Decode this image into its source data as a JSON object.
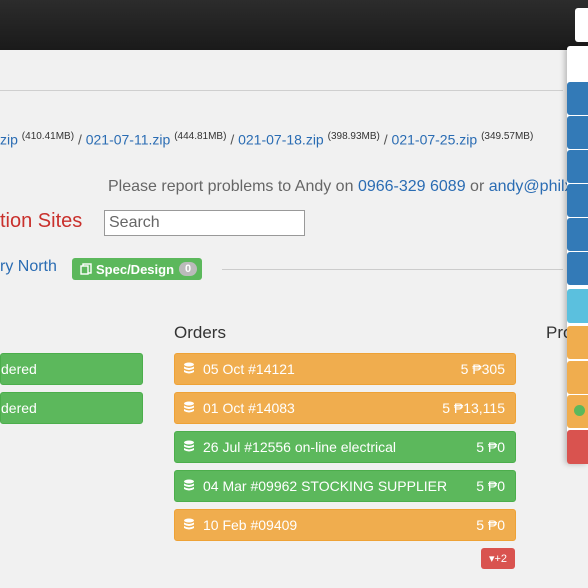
{
  "downloads": [
    {
      "name": "zip",
      "size": "(410.41MB)"
    },
    {
      "name": "021-07-11.zip",
      "size": "(444.81MB)"
    },
    {
      "name": "021-07-18.zip",
      "size": "(398.93MB)"
    },
    {
      "name": "021-07-25.zip",
      "size": "(349.57MB)"
    }
  ],
  "downloads_sep": "/",
  "report": {
    "prefix": "Please report problems to Andy on",
    "phone": "0966-329 6089",
    "or": "or",
    "email": "andy@philx.c"
  },
  "sites_title": "tion Sites",
  "search_placeholder": "Search",
  "site_link": "ry North",
  "spec": {
    "label": "Spec/Design",
    "count": "0"
  },
  "columns": {
    "orders": "Orders",
    "pro": "Pro"
  },
  "left_buttons": [
    "dered",
    "dered"
  ],
  "orders": [
    {
      "label": "05 Oct #14121",
      "value": "5 ₱305",
      "status": "orange"
    },
    {
      "label": "01 Oct #14083",
      "value": "5 ₱13,115",
      "status": "orange"
    },
    {
      "label": "26 Jul #12556 on-line electrical",
      "value": "5 ₱0",
      "status": "green"
    },
    {
      "label": "04 Mar #09962 STOCKING SUPPLIER",
      "value": "5 ₱0",
      "status": "green"
    },
    {
      "label": "10 Feb #09409",
      "value": "5 ₱0",
      "status": "orange"
    }
  ],
  "more_badge": "▾+2",
  "colors": {
    "green": "#5cb85c",
    "orange": "#f0ad4e",
    "blue_tab": "#337ab7",
    "light_blue_tab": "#5bc0de",
    "red": "#d9534f",
    "link": "#2a6cb3",
    "danger_title": "#c9302c"
  },
  "icons": {
    "order": "database-icon",
    "spec": "copy-icon",
    "more": "caret-down-icon"
  }
}
